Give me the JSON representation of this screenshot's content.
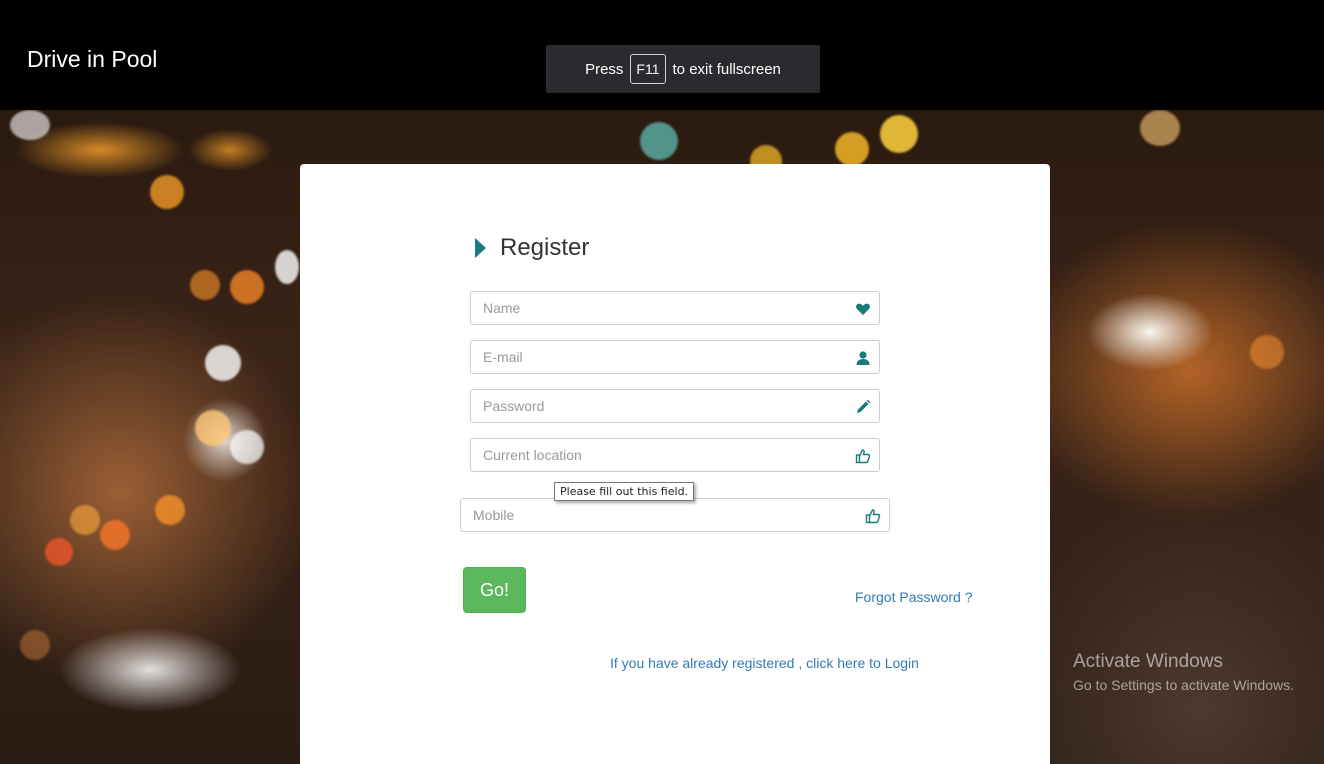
{
  "header": {
    "brand": "Drive in Pool"
  },
  "fullscreen_notice": {
    "prefix": "Press",
    "key": "F11",
    "suffix": "to exit fullscreen"
  },
  "form": {
    "title": "Register",
    "fields": [
      {
        "placeholder": "Name",
        "icon": "heart-icon"
      },
      {
        "placeholder": "E-mail",
        "icon": "user-icon"
      },
      {
        "placeholder": "Password",
        "icon": "pencil-icon"
      },
      {
        "placeholder": "Current location",
        "icon": "thumbs-up-icon"
      },
      {
        "placeholder": "Mobile",
        "icon": "thumbs-up-icon"
      }
    ],
    "validation_tooltip": "Please fill out this field.",
    "submit_label": "Go!",
    "forgot_password": "Forgot Password ?",
    "login_link": "If you have already registered , click here to Login"
  },
  "watermark": {
    "title": "Activate Windows",
    "subtitle": "Go to Settings to activate Windows."
  },
  "colors": {
    "accent": "#1b7a7a",
    "button": "#5cb85c",
    "link": "#337ab7"
  }
}
